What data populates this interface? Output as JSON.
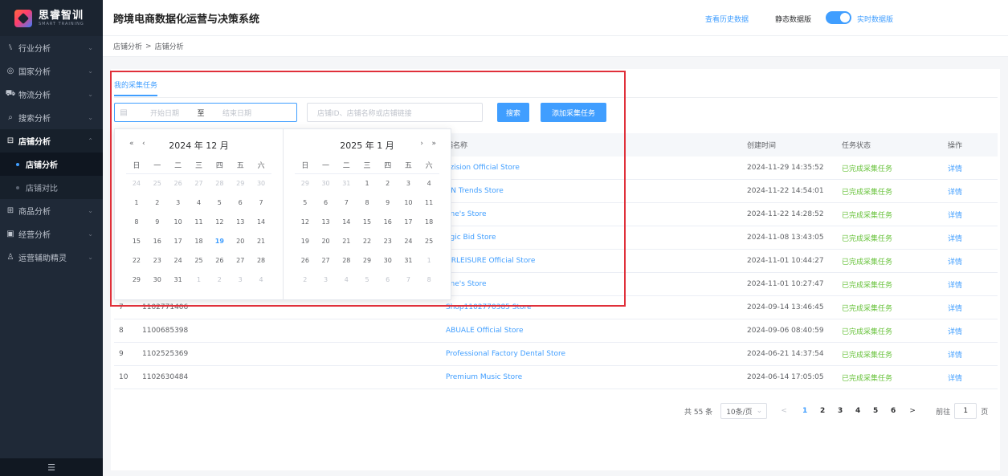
{
  "brand": {
    "name_cn": "思睿智训",
    "name_en": "SMART TRAINING"
  },
  "sidebar": {
    "items": [
      {
        "icon": "industry-icon",
        "glyph": "⑊",
        "label": "行业分析",
        "open": false
      },
      {
        "icon": "globe-icon",
        "glyph": "◎",
        "label": "国家分析",
        "open": false
      },
      {
        "icon": "truck-icon",
        "glyph": "⛟",
        "label": "物流分析",
        "open": false
      },
      {
        "icon": "search-icon",
        "glyph": "⌕",
        "label": "搜索分析",
        "open": false
      },
      {
        "icon": "store-icon",
        "glyph": "⊟",
        "label": "店铺分析",
        "open": true
      },
      {
        "icon": "grid-icon",
        "glyph": "⊞",
        "label": "商品分析",
        "open": false
      },
      {
        "icon": "chart-icon",
        "glyph": "▣",
        "label": "经营分析",
        "open": false
      },
      {
        "icon": "assistant-icon",
        "glyph": "♙",
        "label": "运营辅助精灵",
        "open": false
      }
    ],
    "sub_items": [
      "店铺分析",
      "店铺对比"
    ],
    "collapse_glyph": "☰"
  },
  "header": {
    "title": "跨境电商数据化运营与决策系统",
    "history_link": "查看历史数据",
    "static_label": "静态数据版",
    "live_label": "实时数据版"
  },
  "breadcrumb": {
    "parent": "店铺分析",
    "sep": ">",
    "current": "店铺分析"
  },
  "tab": {
    "label": "我的采集任务"
  },
  "filters": {
    "start_placeholder": "开始日期",
    "range_sep": "至",
    "end_placeholder": "结束日期",
    "search_placeholder": "店铺ID、店铺名称或店铺链接",
    "search_btn": "搜索",
    "add_btn": "添加采集任务"
  },
  "table": {
    "columns": [
      "",
      "",
      "铺名称",
      "创建时间",
      "任务状态",
      "操作"
    ],
    "rows": [
      {
        "idx": "",
        "id": "",
        "name": "ozision Official Store",
        "time": "2024-11-29 14:35:52",
        "status": "已完成采集任务",
        "op": "详情"
      },
      {
        "idx": "",
        "id": "",
        "name": "RN Trends Store",
        "time": "2024-11-22 14:54:01",
        "status": "已完成采集任务",
        "op": "详情"
      },
      {
        "idx": "",
        "id": "",
        "name": "one's Store",
        "time": "2024-11-22 14:28:52",
        "status": "已完成采集任务",
        "op": "详情"
      },
      {
        "idx": "",
        "id": "",
        "name": "agic Bid Store",
        "time": "2024-11-08 13:43:05",
        "status": "已完成采集任务",
        "op": "详情"
      },
      {
        "idx": "",
        "id": "",
        "name": "HRLEISURE Official Store",
        "time": "2024-11-01 10:44:27",
        "status": "已完成采集任务",
        "op": "详情"
      },
      {
        "idx": "",
        "id": "",
        "name": "one's Store",
        "time": "2024-11-01 10:27:47",
        "status": "已完成采集任务",
        "op": "详情"
      },
      {
        "idx": "7",
        "id": "1102771406",
        "name": "Shop1102770385 Store",
        "time": "2024-09-14 13:46:45",
        "status": "已完成采集任务",
        "op": "详情"
      },
      {
        "idx": "8",
        "id": "1100685398",
        "name": "ABUALE Official Store",
        "time": "2024-09-06 08:40:59",
        "status": "已完成采集任务",
        "op": "详情"
      },
      {
        "idx": "9",
        "id": "1102525369",
        "name": "Professional Factory Dental Store",
        "time": "2024-06-21 14:37:54",
        "status": "已完成采集任务",
        "op": "详情"
      },
      {
        "idx": "10",
        "id": "1102630484",
        "name": "Premium Music Store",
        "time": "2024-06-14 17:05:05",
        "status": "已完成采集任务",
        "op": "详情"
      }
    ]
  },
  "pagination": {
    "total": "共 55 条",
    "page_size": "10条/页",
    "prev": "<",
    "pages": [
      "1",
      "2",
      "3",
      "4",
      "5",
      "6"
    ],
    "current": "1",
    "next": ">",
    "goto_label": "前往",
    "goto_value": "1",
    "goto_suffix": "页"
  },
  "datepicker": {
    "weekdays": [
      "日",
      "一",
      "二",
      "三",
      "四",
      "五",
      "六"
    ],
    "left": {
      "title": "2024 年 12 月",
      "nav_prev_year": "«",
      "nav_prev_month": "‹",
      "days": [
        [
          "24",
          "dim"
        ],
        [
          "25",
          "dim"
        ],
        [
          "26",
          "dim"
        ],
        [
          "27",
          "dim"
        ],
        [
          "28",
          "dim"
        ],
        [
          "29",
          "dim"
        ],
        [
          "30",
          "dim"
        ],
        [
          "1",
          ""
        ],
        [
          "2",
          ""
        ],
        [
          "3",
          ""
        ],
        [
          "4",
          ""
        ],
        [
          "5",
          ""
        ],
        [
          "6",
          ""
        ],
        [
          "7",
          ""
        ],
        [
          "8",
          ""
        ],
        [
          "9",
          ""
        ],
        [
          "10",
          ""
        ],
        [
          "11",
          ""
        ],
        [
          "12",
          ""
        ],
        [
          "13",
          ""
        ],
        [
          "14",
          ""
        ],
        [
          "15",
          ""
        ],
        [
          "16",
          ""
        ],
        [
          "17",
          ""
        ],
        [
          "18",
          ""
        ],
        [
          "19",
          "today"
        ],
        [
          "20",
          ""
        ],
        [
          "21",
          ""
        ],
        [
          "22",
          ""
        ],
        [
          "23",
          ""
        ],
        [
          "24",
          ""
        ],
        [
          "25",
          ""
        ],
        [
          "26",
          ""
        ],
        [
          "27",
          ""
        ],
        [
          "28",
          ""
        ],
        [
          "29",
          ""
        ],
        [
          "30",
          ""
        ],
        [
          "31",
          ""
        ],
        [
          "1",
          "dim"
        ],
        [
          "2",
          "dim"
        ],
        [
          "3",
          "dim"
        ],
        [
          "4",
          "dim"
        ]
      ]
    },
    "right": {
      "title": "2025 年 1 月",
      "nav_next_month": "›",
      "nav_next_year": "»",
      "days": [
        [
          "29",
          "dim"
        ],
        [
          "30",
          "dim"
        ],
        [
          "31",
          "dim"
        ],
        [
          "1",
          ""
        ],
        [
          "2",
          ""
        ],
        [
          "3",
          ""
        ],
        [
          "4",
          ""
        ],
        [
          "5",
          ""
        ],
        [
          "6",
          ""
        ],
        [
          "7",
          ""
        ],
        [
          "8",
          ""
        ],
        [
          "9",
          ""
        ],
        [
          "10",
          ""
        ],
        [
          "11",
          ""
        ],
        [
          "12",
          ""
        ],
        [
          "13",
          ""
        ],
        [
          "14",
          ""
        ],
        [
          "15",
          ""
        ],
        [
          "16",
          ""
        ],
        [
          "17",
          ""
        ],
        [
          "18",
          ""
        ],
        [
          "19",
          ""
        ],
        [
          "20",
          ""
        ],
        [
          "21",
          ""
        ],
        [
          "22",
          ""
        ],
        [
          "23",
          ""
        ],
        [
          "24",
          ""
        ],
        [
          "25",
          ""
        ],
        [
          "26",
          ""
        ],
        [
          "27",
          ""
        ],
        [
          "28",
          ""
        ],
        [
          "29",
          ""
        ],
        [
          "30",
          ""
        ],
        [
          "31",
          ""
        ],
        [
          "1",
          "dim"
        ],
        [
          "2",
          "dim"
        ],
        [
          "3",
          "dim"
        ],
        [
          "4",
          "dim"
        ],
        [
          "5",
          "dim"
        ],
        [
          "6",
          "dim"
        ],
        [
          "7",
          "dim"
        ],
        [
          "8",
          "dim"
        ]
      ]
    }
  },
  "colors": {
    "accent": "#409eff",
    "success": "#67c23a",
    "highlight_box": "#e0303a",
    "sidebar_bg": "#1f2937"
  }
}
